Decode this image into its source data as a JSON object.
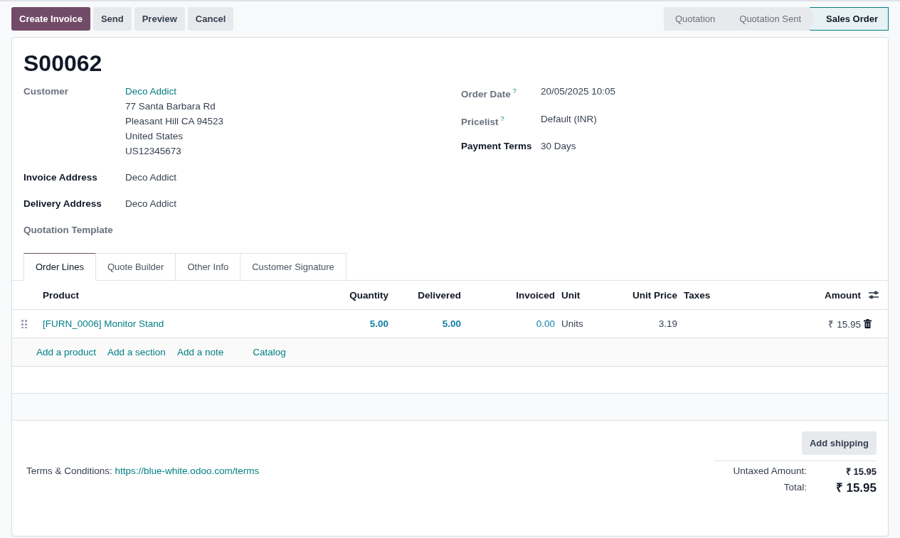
{
  "actions": [
    {
      "label": "Create Invoice",
      "primary": true
    },
    {
      "label": "Send",
      "primary": false
    },
    {
      "label": "Preview",
      "primary": false
    },
    {
      "label": "Cancel",
      "primary": false
    }
  ],
  "stages": [
    {
      "label": "Quotation",
      "selected": false
    },
    {
      "label": "Quotation Sent",
      "selected": false
    },
    {
      "label": "Sales Order",
      "selected": true
    }
  ],
  "record": {
    "title": "S00062"
  },
  "left_fields": [
    {
      "label": "Customer",
      "muted": true,
      "value": "Deco Addict",
      "link": true,
      "address": [
        "77 Santa Barbara Rd",
        "Pleasant Hill CA 94523",
        "United States",
        "US12345673"
      ]
    },
    {
      "label": "Invoice Address",
      "muted": false,
      "value": "Deco Addict",
      "link": false
    },
    {
      "label": "Delivery Address",
      "muted": false,
      "value": "Deco Addict",
      "link": false
    },
    {
      "label": "Quotation Template",
      "muted": true
    }
  ],
  "right_fields": [
    {
      "label": "Order Date",
      "help": "?",
      "muted": true,
      "value": "20/05/2025 10:05"
    },
    {
      "label": "Pricelist",
      "help": "?",
      "muted": true,
      "value": "Default (INR)"
    },
    {
      "label": "Payment Terms",
      "muted": false,
      "value": "30 Days"
    }
  ],
  "tabs": [
    {
      "label": "Order Lines",
      "selected": true
    },
    {
      "label": "Quote Builder",
      "selected": false
    },
    {
      "label": "Other Info",
      "selected": false
    },
    {
      "label": "Customer Signature",
      "selected": false
    }
  ],
  "table": {
    "columns": [
      "Product",
      "Quantity",
      "Delivered",
      "Invoiced",
      "Unit",
      "Unit Price",
      "Taxes",
      "Amount"
    ],
    "rows": [
      {
        "product": "[FURN_0006] Monitor Stand",
        "quantity": "5.00",
        "delivered": "5.00",
        "invoiced": "0.00",
        "unit": "Units",
        "unit_price": "3.19",
        "amount": "₹ 15.95"
      }
    ],
    "add_links": [
      "Add a product",
      "Add a section",
      "Add a note",
      "Catalog"
    ]
  },
  "footer": {
    "terms_label": "Terms & Conditions:",
    "terms_link": "https://blue-white.odoo.com/terms",
    "shipping_button": "Add shipping",
    "totals": [
      {
        "label": "Untaxed Amount:",
        "value": "₹ 15.95",
        "grand": false
      },
      {
        "label": "Total:",
        "value": "₹ 15.95",
        "grand": true
      }
    ]
  }
}
